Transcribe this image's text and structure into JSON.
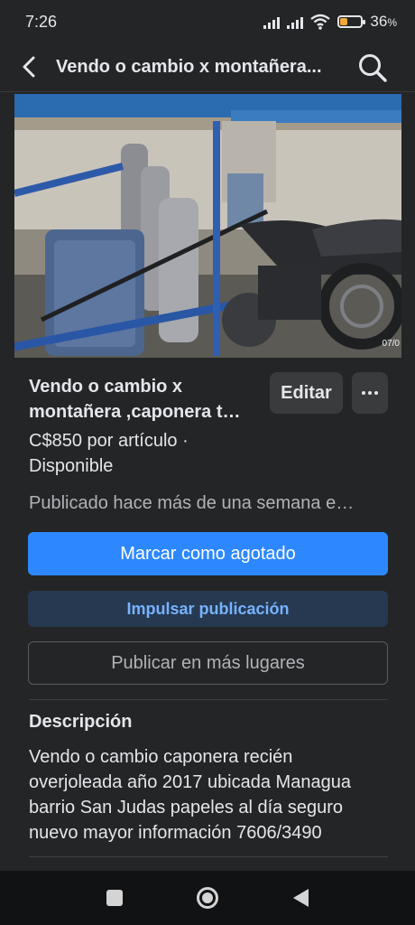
{
  "status_bar": {
    "time": "7:26",
    "battery_percent": "36",
    "battery_level": 0.36,
    "battery_color": "#f2a83b",
    "icons": [
      "signal-icon",
      "signal-icon",
      "wifi-icon",
      "battery-icon"
    ]
  },
  "header": {
    "back_icon": "back-arrow-icon",
    "title": "Vendo o cambio x montañera...",
    "search_icon": "search-icon"
  },
  "photo": {
    "date_stamp": "07/0"
  },
  "listing": {
    "title_line1": "Vendo o cambio x",
    "title_line2": "montañera ,caponera  t…",
    "edit_label": "Editar",
    "more_icon": "more-dots-icon",
    "price_line1": "C$850 por artículo ·",
    "price_line2": "Disponible",
    "published": "Publicado hace más de una semana e…"
  },
  "actions": {
    "mark_sold": "Marcar como agotado",
    "boost": "Impulsar publicación",
    "publish_more": "Publicar en más lugares"
  },
  "description": {
    "heading": "Descripción",
    "text": "Vendo o cambio caponera recién overjoleada año 2017 ubicada Managua barrio San Judas papeles al día seguro nuevo mayor información 7606/3490"
  },
  "colors": {
    "background": "#242526",
    "primary": "#2d88ff",
    "boost_bg": "#263951",
    "boost_text": "#77b3ff"
  },
  "system_nav": {
    "icons": [
      "recent-apps-icon",
      "home-icon",
      "back-icon"
    ]
  }
}
